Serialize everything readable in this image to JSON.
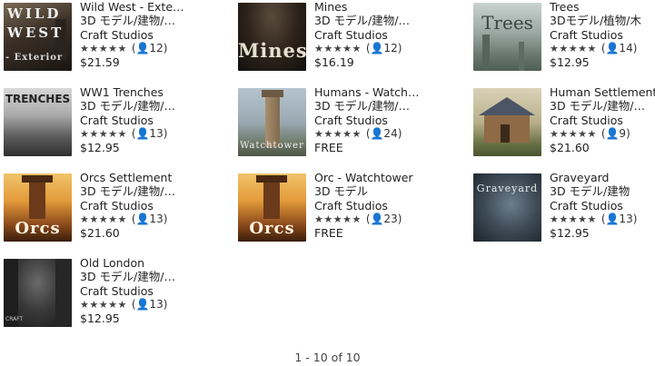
{
  "items": [
    {
      "title": "Wild West - Exte…",
      "category": "3D モデル/建物/…",
      "publisher": "Craft Studios",
      "stars": "★★★★★",
      "reviews": "(👤12)",
      "price": "$21.59",
      "thumb_text_1": "WILD",
      "thumb_text_2": "WEST",
      "thumb_text_3": "- Exterior"
    },
    {
      "title": "Mines",
      "category": "3D モデル/建物/…",
      "publisher": "Craft Studios",
      "stars": "★★★★★",
      "reviews": "(👤12)",
      "price": "$16.19",
      "thumb_text_1": "Mines"
    },
    {
      "title": "Trees",
      "category": "3Dモデル/植物/木",
      "publisher": "Craft Studios",
      "stars": "★★★★★",
      "reviews": "(👤14)",
      "price": "$12.95",
      "thumb_text_1": "Trees"
    },
    {
      "title": "WW1 Trenches",
      "category": "3D モデル/建物/…",
      "publisher": "Craft Studios",
      "stars": "★★★★★",
      "reviews": "(👤13)",
      "price": "$12.95",
      "thumb_text_1": "TRENCHES"
    },
    {
      "title": "Humans - Watch…",
      "category": "3D モデル/建物/…",
      "publisher": "Craft Studios",
      "stars": "★★★★★",
      "reviews": "(👤24)",
      "price": "FREE",
      "thumb_text_1": "Watchtower"
    },
    {
      "title": "Human Settlement",
      "category": "3D モデル/建物/…",
      "publisher": "Craft Studios",
      "stars": "★★★★★",
      "reviews": "(👤9)",
      "price": "$21.60"
    },
    {
      "title": "Orcs Settlement",
      "category": "3D モデル/建物/…",
      "publisher": "Craft Studios",
      "stars": "★★★★★",
      "reviews": "(👤13)",
      "price": "$21.60",
      "thumb_text_1": "Orcs"
    },
    {
      "title": "Orc - Watchtower",
      "category": "3D モデル",
      "publisher": "Craft Studios",
      "stars": "★★★★★",
      "reviews": "(👤23)",
      "price": "FREE",
      "thumb_text_1": "Orcs"
    },
    {
      "title": "Graveyard",
      "category": "3D モデル/建物",
      "publisher": "Craft Studios",
      "stars": "★★★★★",
      "reviews": "(👤13)",
      "price": "$12.95",
      "thumb_text_1": "Graveyard"
    },
    {
      "title": "Old London",
      "category": "3D モデル/建物/…",
      "publisher": "Craft Studios",
      "stars": "★★★★★",
      "reviews": "(👤13)",
      "price": "$12.95",
      "thumb_text_1": "CRAFT"
    }
  ],
  "pagination": "1 - 10 of 10"
}
